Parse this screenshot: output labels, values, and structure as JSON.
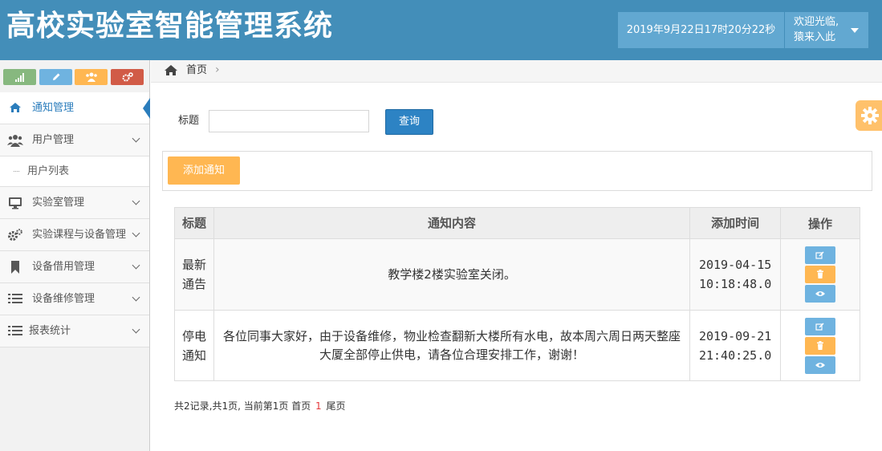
{
  "header": {
    "title": "高校实验室智能管理系统",
    "datetime": "2019年9月22日17时20分22秒",
    "welcome": "欢迎光临,",
    "username": "猿来入此"
  },
  "sidebar": {
    "shortcuts": [
      {
        "icon": "signal-icon",
        "color": "#87b87f"
      },
      {
        "icon": "pencil-icon",
        "color": "#6fb3e0"
      },
      {
        "icon": "users-icon",
        "color": "#ffb752"
      },
      {
        "icon": "cogs-icon",
        "color": "#d15b47"
      }
    ],
    "items": [
      {
        "label": "通知管理",
        "icon": "home-icon",
        "active": true
      },
      {
        "label": "用户管理",
        "icon": "users-icon"
      },
      {
        "label": "用户列表",
        "sub": true
      },
      {
        "label": "实验室管理",
        "icon": "desktop-icon"
      },
      {
        "label": "实验课程与设备管理",
        "icon": "cogs-icon"
      },
      {
        "label": "设备借用管理",
        "icon": "bookmark-icon"
      },
      {
        "label": "设备维修管理",
        "icon": "list-icon"
      },
      {
        "label": "报表统计",
        "icon": "list-icon"
      }
    ]
  },
  "breadcrumb": {
    "home": "首页"
  },
  "search": {
    "label": "标题",
    "value": "",
    "button": "查询"
  },
  "toolbar": {
    "add_label": "添加通知"
  },
  "table": {
    "headers": [
      "标题",
      "通知内容",
      "添加时间",
      "操作"
    ],
    "rows": [
      {
        "title": "最新通告",
        "content": "教学楼2楼实验室关闭。",
        "time": "2019-04-15 10:18:48.0"
      },
      {
        "title": "停电通知",
        "content": "各位同事大家好，由于设备维修，物业检查翻新大楼所有水电，故本周六周日两天整座大厦全部停止供电，请各位合理安排工作，谢谢！",
        "time": "2019-09-21 21:40:25.0"
      }
    ]
  },
  "pagination": {
    "summary": "共2记录,共1页, 当前第1页",
    "first": "首页",
    "current": "1",
    "last": "尾页"
  }
}
